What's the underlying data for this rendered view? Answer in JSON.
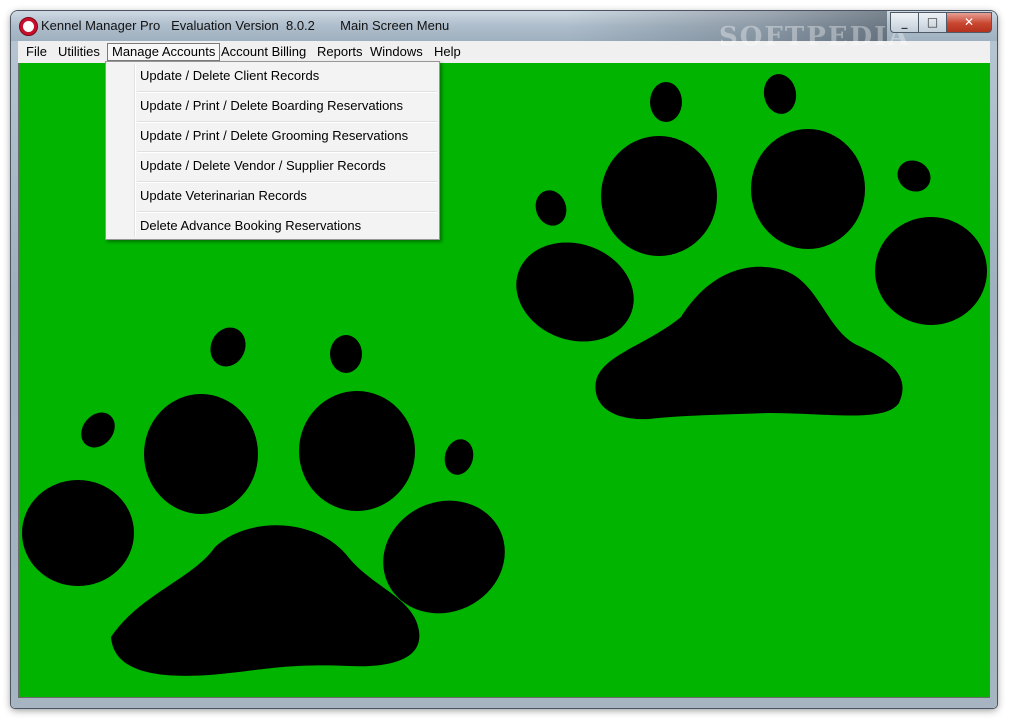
{
  "window": {
    "title": "Kennel Manager Pro   Evaluation Version  8.0.2       Main Screen Menu",
    "minimize_glyph": "_",
    "maximize_glyph": "□",
    "close_glyph": "✕"
  },
  "menubar": {
    "items": [
      "File",
      "Utilities",
      "Manage Accounts",
      "Account Billing",
      "Reports",
      "Windows",
      "Help"
    ],
    "active": "Manage Accounts"
  },
  "dropdown": {
    "items": [
      "Update / Delete Client Records",
      "Update / Print / Delete Boarding Reservations",
      "Update / Print / Delete Grooming Reservations",
      "Update / Delete Vendor / Supplier Records",
      "Update Veterinarian Records",
      "Delete Advance Booking Reservations"
    ]
  },
  "watermark": "SOFTPEDIA",
  "colors": {
    "client_background": "#00b400",
    "paw_print": "#000000"
  },
  "icons": {
    "app": "kennel-app-icon",
    "paws": "paw-print-icon"
  }
}
